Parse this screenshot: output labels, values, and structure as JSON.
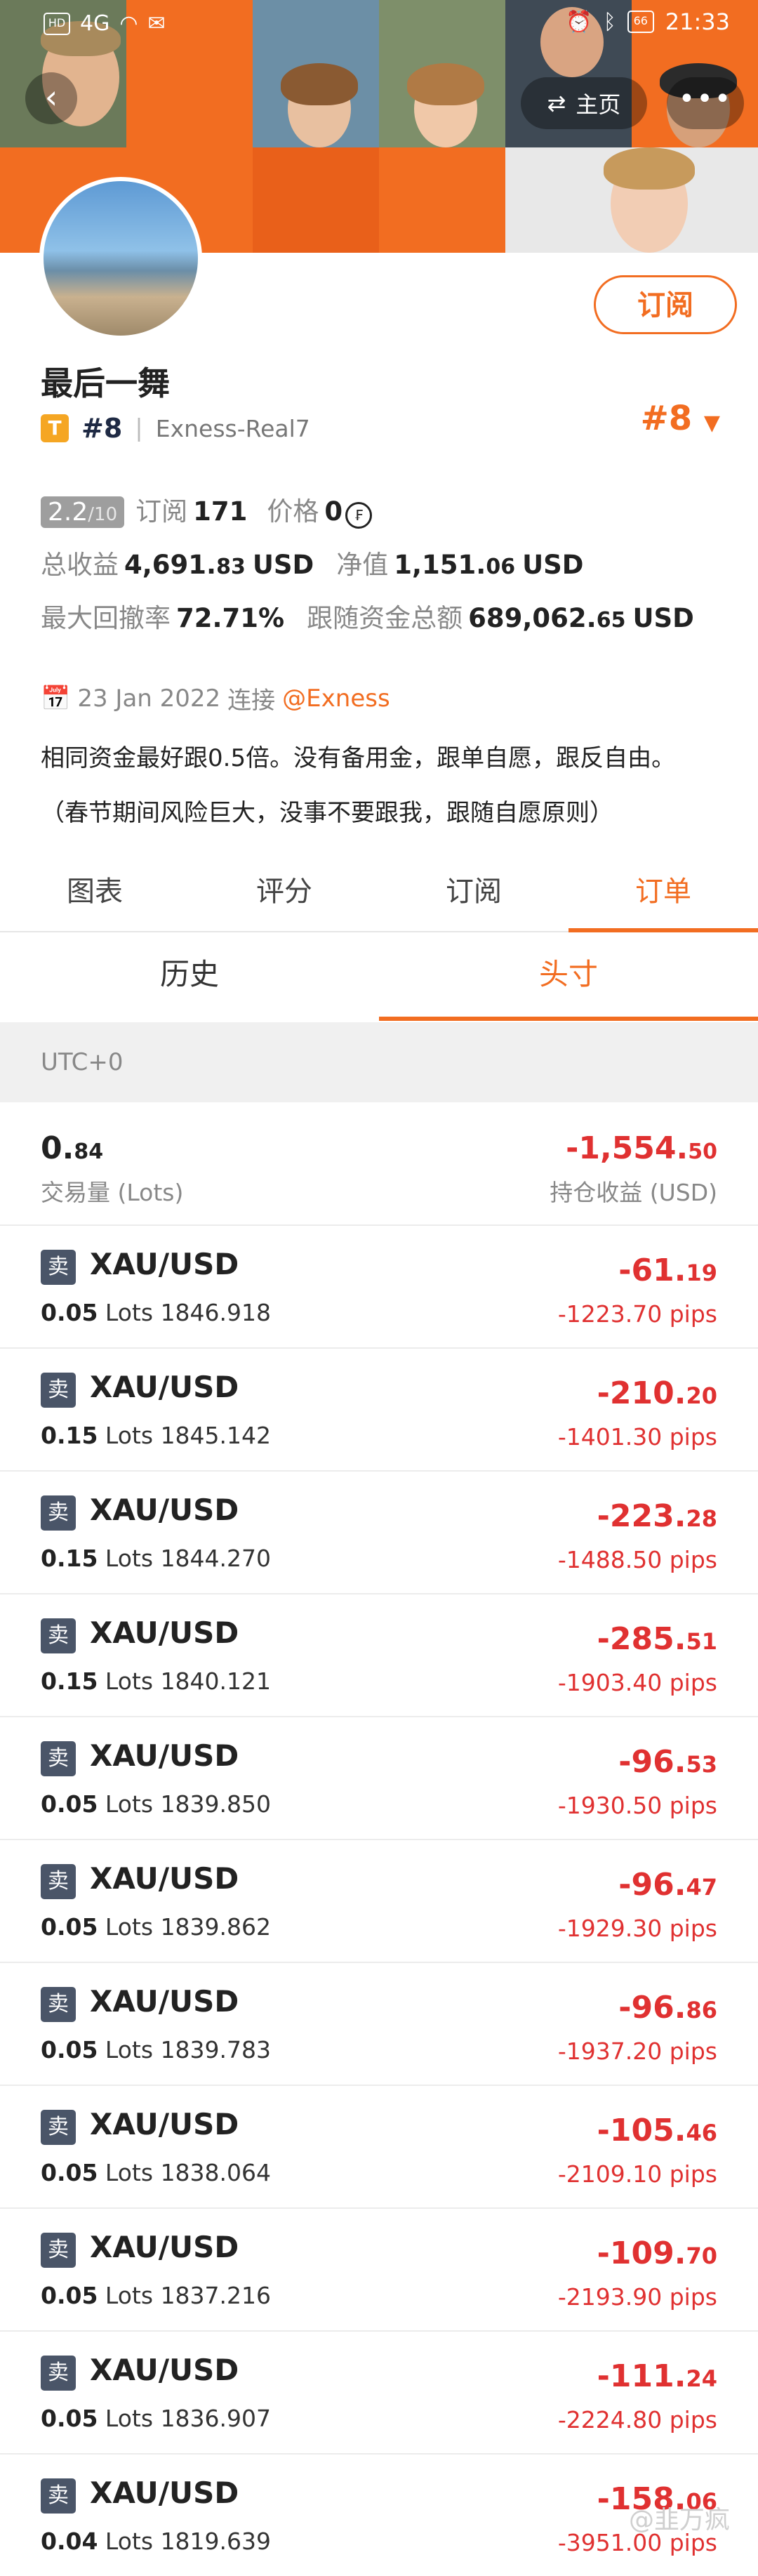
{
  "status_bar": {
    "time": "21:33",
    "battery": "66",
    "network": "4G"
  },
  "header": {
    "home_label": "主页",
    "subscribe_label": "订阅"
  },
  "profile": {
    "name": "最后一舞",
    "tier_badge": "T",
    "rank_small": "#8",
    "broker_account": "Exness-Real7",
    "rank_big": "#8",
    "score": "2.2",
    "score_max": "/10",
    "subscribe_label": "订阅",
    "subscribers": "171",
    "price_label": "价格",
    "price": "0",
    "total_profit_label": "总收益",
    "total_profit_int": "4,691.",
    "total_profit_dec": "83",
    "currency": "USD",
    "equity_label": "净值",
    "equity_int": "1,151.",
    "equity_dec": "06",
    "drawdown_label": "最大回撤率",
    "drawdown": "72.71%",
    "follow_total_label": "跟随资金总额",
    "follow_total_int": "689,062.",
    "follow_total_dec": "65",
    "connect_date": "23 Jan 2022",
    "connect_label": "连接",
    "broker_link": "@Exness",
    "description_line1": "相同资金最好跟0.5倍。没有备用金，跟单自愿，跟反自由。",
    "description_line2": "（春节期间风险巨大，没事不要跟我，跟随自愿原则）"
  },
  "tabs": [
    "图表",
    "评分",
    "订阅",
    "订单"
  ],
  "subtabs": [
    "历史",
    "头寸"
  ],
  "timezone": "UTC+0",
  "summary": {
    "lots_int": "0.",
    "lots_dec": "84",
    "lots_label": "交易量 (Lots)",
    "pnl_int": "-1,554.",
    "pnl_dec": "50",
    "pnl_label": "持仓收益 (USD)"
  },
  "orders": [
    {
      "side": "卖",
      "symbol": "XAU/USD",
      "lots": "0.05",
      "lots_unit": "Lots",
      "price": "1846.918",
      "pnl_int": "-61.",
      "pnl_dec": "19",
      "pips": "-1223.70 pips"
    },
    {
      "side": "卖",
      "symbol": "XAU/USD",
      "lots": "0.15",
      "lots_unit": "Lots",
      "price": "1845.142",
      "pnl_int": "-210.",
      "pnl_dec": "20",
      "pips": "-1401.30 pips"
    },
    {
      "side": "卖",
      "symbol": "XAU/USD",
      "lots": "0.15",
      "lots_unit": "Lots",
      "price": "1844.270",
      "pnl_int": "-223.",
      "pnl_dec": "28",
      "pips": "-1488.50 pips"
    },
    {
      "side": "卖",
      "symbol": "XAU/USD",
      "lots": "0.15",
      "lots_unit": "Lots",
      "price": "1840.121",
      "pnl_int": "-285.",
      "pnl_dec": "51",
      "pips": "-1903.40 pips"
    },
    {
      "side": "卖",
      "symbol": "XAU/USD",
      "lots": "0.05",
      "lots_unit": "Lots",
      "price": "1839.850",
      "pnl_int": "-96.",
      "pnl_dec": "53",
      "pips": "-1930.50 pips"
    },
    {
      "side": "卖",
      "symbol": "XAU/USD",
      "lots": "0.05",
      "lots_unit": "Lots",
      "price": "1839.862",
      "pnl_int": "-96.",
      "pnl_dec": "47",
      "pips": "-1929.30 pips"
    },
    {
      "side": "卖",
      "symbol": "XAU/USD",
      "lots": "0.05",
      "lots_unit": "Lots",
      "price": "1839.783",
      "pnl_int": "-96.",
      "pnl_dec": "86",
      "pips": "-1937.20 pips"
    },
    {
      "side": "卖",
      "symbol": "XAU/USD",
      "lots": "0.05",
      "lots_unit": "Lots",
      "price": "1838.064",
      "pnl_int": "-105.",
      "pnl_dec": "46",
      "pips": "-2109.10 pips"
    },
    {
      "side": "卖",
      "symbol": "XAU/USD",
      "lots": "0.05",
      "lots_unit": "Lots",
      "price": "1837.216",
      "pnl_int": "-109.",
      "pnl_dec": "70",
      "pips": "-2193.90 pips"
    },
    {
      "side": "卖",
      "symbol": "XAU/USD",
      "lots": "0.05",
      "lots_unit": "Lots",
      "price": "1836.907",
      "pnl_int": "-111.",
      "pnl_dec": "24",
      "pips": "-2224.80 pips"
    },
    {
      "side": "卖",
      "symbol": "XAU/USD",
      "lots": "0.04",
      "lots_unit": "Lots",
      "price": "1819.639",
      "pnl_int": "-158.",
      "pnl_dec": "06",
      "pips": "-3951.00 pips"
    }
  ],
  "watermark": "@韭万疯",
  "colors": {
    "accent": "#f26d21",
    "loss": "#e03131",
    "badge": "#4a5568"
  }
}
